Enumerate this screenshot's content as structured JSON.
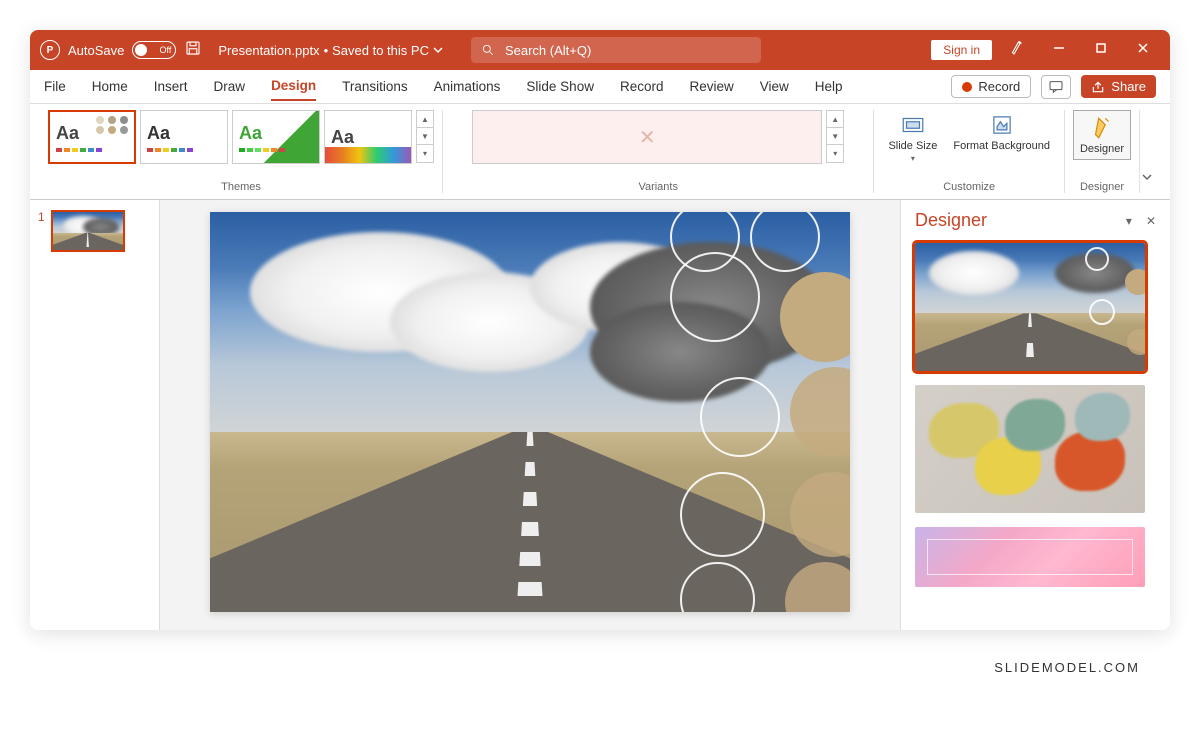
{
  "titlebar": {
    "autosave_label": "AutoSave",
    "autosave_state": "Off",
    "filename": "Presentation.pptx",
    "save_status": "Saved to this PC",
    "search_placeholder": "Search (Alt+Q)",
    "signin_label": "Sign in"
  },
  "menu": {
    "tabs": [
      "File",
      "Home",
      "Insert",
      "Draw",
      "Design",
      "Transitions",
      "Animations",
      "Slide Show",
      "Record",
      "Review",
      "View",
      "Help"
    ],
    "active_tab": "Design",
    "record_label": "Record",
    "share_label": "Share"
  },
  "ribbon": {
    "themes_label": "Themes",
    "variants_label": "Variants",
    "customize_label": "Customize",
    "designer_label": "Designer",
    "slide_size_label": "Slide Size",
    "format_bg_label": "Format Background",
    "designer_btn_label": "Designer"
  },
  "thumbnails": {
    "slides": [
      {
        "number": "1"
      }
    ]
  },
  "designer_pane": {
    "title": "Designer"
  },
  "watermark": "SLIDEMODEL.COM"
}
